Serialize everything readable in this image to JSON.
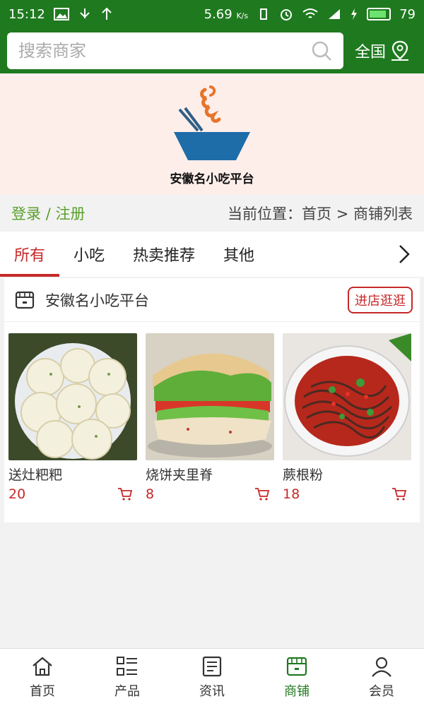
{
  "status": {
    "time": "15:12",
    "speed": "5.69",
    "speed_unit": "K/s",
    "battery": "79"
  },
  "search": {
    "placeholder": "搜索商家"
  },
  "region": {
    "label": "全国"
  },
  "brand": {
    "name": "安徽名小吃平台"
  },
  "account": {
    "login": "登录",
    "sep": "/",
    "register": "注册"
  },
  "breadcrumb": {
    "prefix": "当前位置：",
    "home": "首页",
    "arrow": ">",
    "current": "商铺列表"
  },
  "tabs": [
    {
      "label": "所有",
      "active": true
    },
    {
      "label": "小吃"
    },
    {
      "label": "热卖推荐"
    },
    {
      "label": "其他"
    }
  ],
  "shop": {
    "name": "安徽名小吃平台",
    "visit_label": "进店逛逛",
    "products": [
      {
        "name": "送灶粑粑",
        "price": "20"
      },
      {
        "name": "烧饼夹里脊",
        "price": "8"
      },
      {
        "name": "蕨根粉",
        "price": "18"
      }
    ]
  },
  "nav": [
    {
      "label": "首页",
      "icon": "home-icon"
    },
    {
      "label": "产品",
      "icon": "list-icon"
    },
    {
      "label": "资讯",
      "icon": "news-icon"
    },
    {
      "label": "商铺",
      "icon": "store-icon",
      "active": true
    },
    {
      "label": "会员",
      "icon": "user-icon"
    }
  ],
  "colors": {
    "header": "#1f7a1f",
    "accent": "#c62828",
    "login": "#5aa02c"
  }
}
